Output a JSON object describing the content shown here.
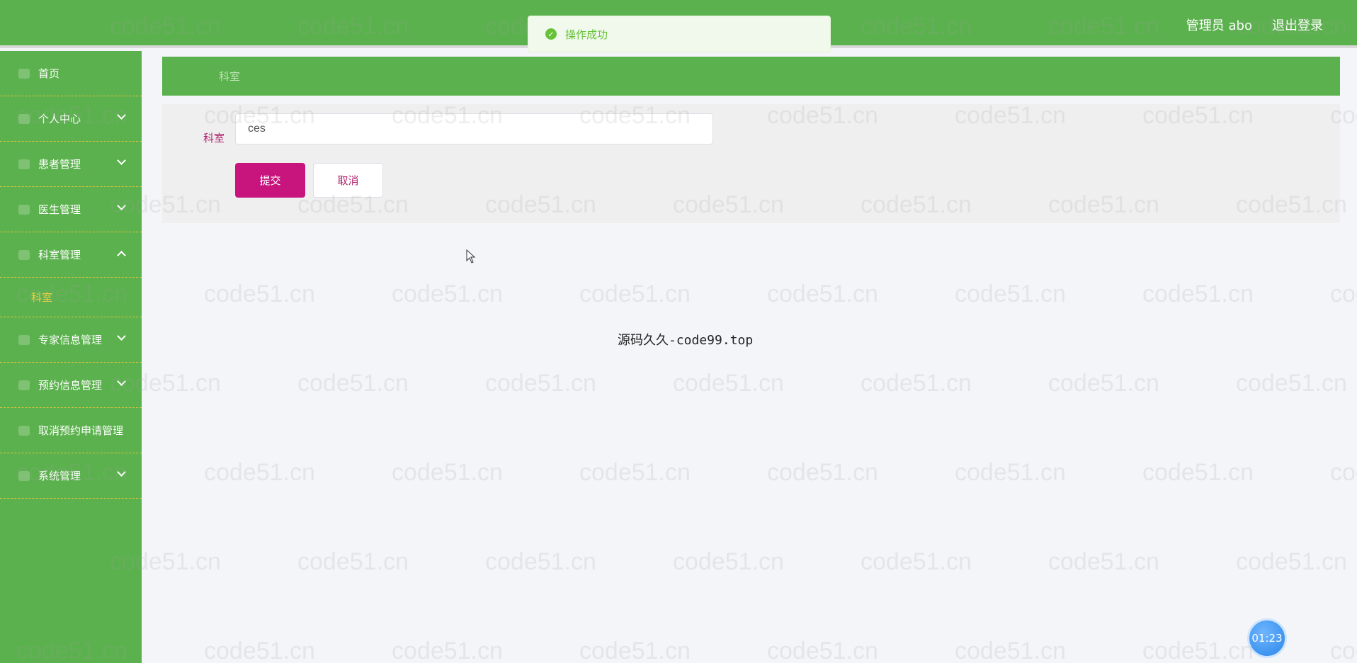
{
  "header": {
    "user": "管理员 abo",
    "logout": "退出登录"
  },
  "toast": {
    "message": "操作成功"
  },
  "sidebar": {
    "items": [
      {
        "label": "首页"
      },
      {
        "label": "个人中心"
      },
      {
        "label": "患者管理"
      },
      {
        "label": "医生管理"
      },
      {
        "label": "科室管理"
      },
      {
        "label": "科室"
      },
      {
        "label": "专家信息管理"
      },
      {
        "label": "预约信息管理"
      },
      {
        "label": "取消预约申请管理"
      },
      {
        "label": "系统管理"
      }
    ]
  },
  "breadcrumb": {
    "current": "科室"
  },
  "form": {
    "label": "科室",
    "value": "ces",
    "submit": "提交",
    "cancel": "取消"
  },
  "center_text": "源码久久-code99.top",
  "timer": "01:23",
  "watermark": "code51.cn",
  "colors": {
    "primary_green": "#5bb14d",
    "submit_magenta": "#c8157e",
    "submenu_yellow": "#f2d13f",
    "toast_green": "#67c23a"
  }
}
